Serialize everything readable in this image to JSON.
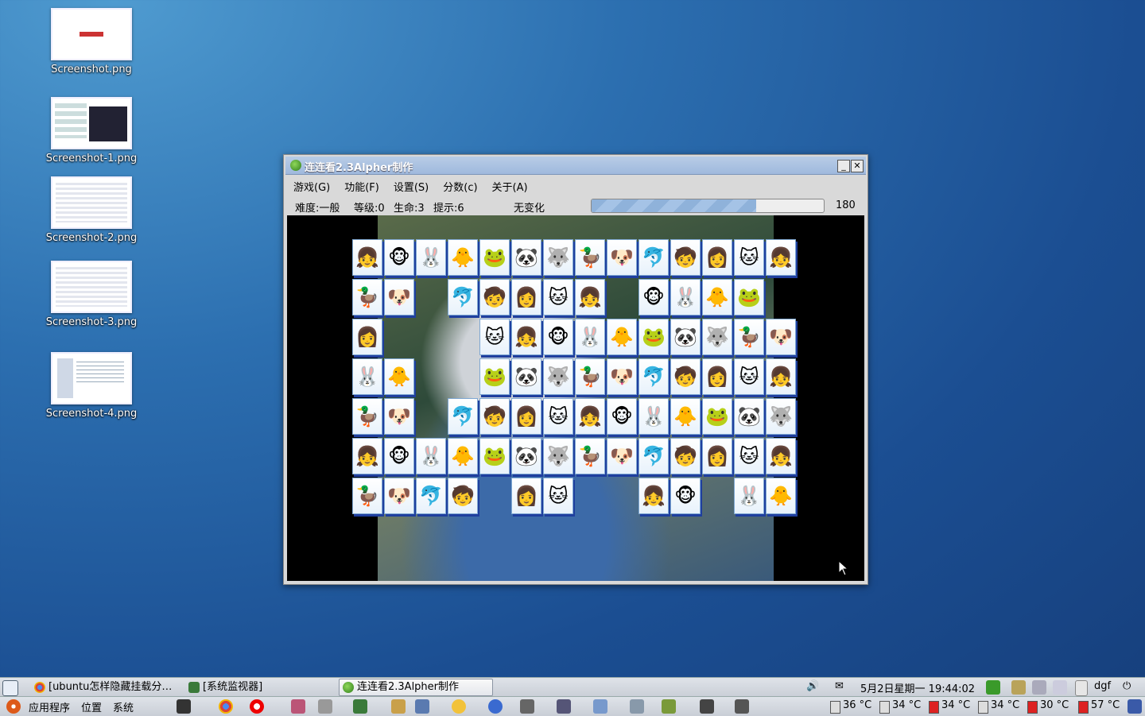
{
  "desktop": {
    "icons": [
      {
        "label": "Screenshot.png"
      },
      {
        "label": "Screenshot-1.png"
      },
      {
        "label": "Screenshot-2.png"
      },
      {
        "label": "Screenshot-3.png"
      },
      {
        "label": "Screenshot-4.png"
      }
    ]
  },
  "window": {
    "title": "连连看2.3Alpher制作",
    "minimize_label": "_",
    "close_label": "✕",
    "menu": [
      "游戏(G)",
      "功能(F)",
      "设置(S)",
      "分数(c)",
      "关于(A)"
    ],
    "status": {
      "difficulty": "难度:一般",
      "level": "等级:0",
      "lives": "生命:3",
      "hints": "提示:6",
      "mode": "无变化",
      "timer_value": "180",
      "timer_fraction": 0.71
    }
  },
  "taskbar": {
    "tasks": [
      {
        "label": "[ubuntu怎样隐藏挂载分…",
        "icon": "chrome-icon",
        "active": false
      },
      {
        "label": "[系统监视器]",
        "icon": "system-monitor-icon",
        "active": false
      },
      {
        "label": "连连看2.3Alpher制作",
        "icon": "game-icon",
        "active": true
      }
    ],
    "clock": "5月2日星期一 19:44:02",
    "user": "dgf"
  },
  "bottom_panel": {
    "menus": [
      "应用程序",
      "位置",
      "系统"
    ],
    "temps": [
      "36 °C",
      "34 °C",
      "34 °C",
      "34 °C",
      "30 °C",
      "57 °C"
    ]
  },
  "colors": {
    "accent": "#9fb9dd",
    "tile_shadow": "#1f3f9e",
    "panel": "#d4d8de"
  }
}
